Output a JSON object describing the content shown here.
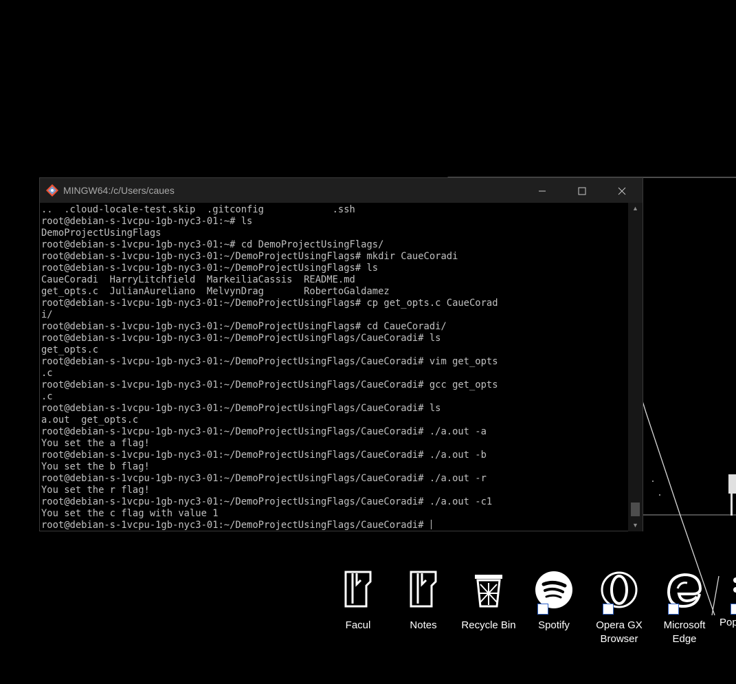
{
  "terminal": {
    "title": "MINGW64:/c/Users/caues",
    "lines": [
      "..  .cloud-locale-test.skip  .gitconfig            .ssh",
      "root@debian-s-1vcpu-1gb-nyc3-01:~# ls",
      "DemoProjectUsingFlags",
      "root@debian-s-1vcpu-1gb-nyc3-01:~# cd DemoProjectUsingFlags/",
      "root@debian-s-1vcpu-1gb-nyc3-01:~/DemoProjectUsingFlags# mkdir CaueCoradi",
      "root@debian-s-1vcpu-1gb-nyc3-01:~/DemoProjectUsingFlags# ls",
      "CaueCoradi  HarryLitchfield  MarkeiliaCassis  README.md",
      "get_opts.c  JulianAureliano  MelvynDrag       RobertoGaldamez",
      "root@debian-s-1vcpu-1gb-nyc3-01:~/DemoProjectUsingFlags# cp get_opts.c CaueCorad",
      "i/",
      "root@debian-s-1vcpu-1gb-nyc3-01:~/DemoProjectUsingFlags# cd CaueCoradi/",
      "root@debian-s-1vcpu-1gb-nyc3-01:~/DemoProjectUsingFlags/CaueCoradi# ls",
      "get_opts.c",
      "root@debian-s-1vcpu-1gb-nyc3-01:~/DemoProjectUsingFlags/CaueCoradi# vim get_opts",
      ".c",
      "root@debian-s-1vcpu-1gb-nyc3-01:~/DemoProjectUsingFlags/CaueCoradi# gcc get_opts",
      ".c",
      "root@debian-s-1vcpu-1gb-nyc3-01:~/DemoProjectUsingFlags/CaueCoradi# ls",
      "a.out  get_opts.c",
      "root@debian-s-1vcpu-1gb-nyc3-01:~/DemoProjectUsingFlags/CaueCoradi# ./a.out -a",
      "You set the a flag!",
      "root@debian-s-1vcpu-1gb-nyc3-01:~/DemoProjectUsingFlags/CaueCoradi# ./a.out -b",
      "You set the b flag!",
      "root@debian-s-1vcpu-1gb-nyc3-01:~/DemoProjectUsingFlags/CaueCoradi# ./a.out -r",
      "You set the r flag!",
      "root@debian-s-1vcpu-1gb-nyc3-01:~/DemoProjectUsingFlags/CaueCoradi# ./a.out -c1",
      "You set the c flag with value 1"
    ],
    "prompt": "root@debian-s-1vcpu-1gb-nyc3-01:~/DemoProjectUsingFlags/CaueCoradi# "
  },
  "desktop_icons": [
    {
      "label": "Facul",
      "icon": "folder-icon"
    },
    {
      "label": "Notes",
      "icon": "folder-icon"
    },
    {
      "label": "Recycle Bin",
      "icon": "recycle-bin-icon"
    },
    {
      "label": "Spotify",
      "icon": "spotify-icon"
    },
    {
      "label": "Opera GX Browser",
      "icon": "opera-gx-icon"
    },
    {
      "label": "Microsoft Edge",
      "icon": "edge-icon"
    },
    {
      "label": "Pop",
      "icon": "app-icon"
    }
  ],
  "colors": {
    "desktop_bg": "#000000",
    "terminal_text": "#c0c0c0",
    "titlebar_bg": "#1f1f1f"
  }
}
